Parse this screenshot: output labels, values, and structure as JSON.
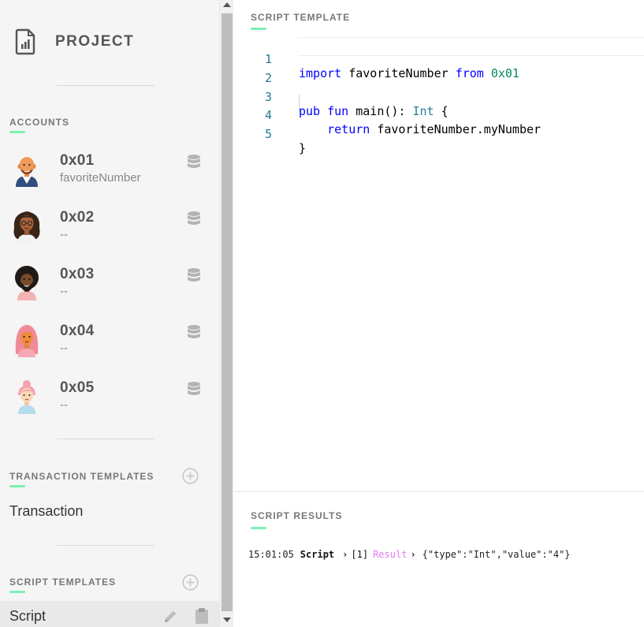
{
  "sidebar": {
    "project_label": "PROJECT",
    "accounts_title": "ACCOUNTS",
    "accounts": [
      {
        "address": "0x01",
        "contract": "favoriteNumber"
      },
      {
        "address": "0x02",
        "contract": "--"
      },
      {
        "address": "0x03",
        "contract": "--"
      },
      {
        "address": "0x04",
        "contract": "--"
      },
      {
        "address": "0x05",
        "contract": "--"
      }
    ],
    "transaction_templates_title": "TRANSACTION TEMPLATES",
    "transaction_templates": [
      "Transaction"
    ],
    "script_templates_title": "SCRIPT TEMPLATES",
    "script_templates": [
      "Script"
    ]
  },
  "editor": {
    "title": "SCRIPT TEMPLATE",
    "line_numbers": [
      "1",
      "2",
      "3",
      "4",
      "5"
    ]
  },
  "results": {
    "title": "SCRIPT RESULTS",
    "entry": {
      "time": "15:01:05",
      "kind": "Script",
      "index": "[1]",
      "label": "Result",
      "value": "{\"type\":\"Int\",\"value\":\"4\"}"
    }
  },
  "colors": {
    "accent": "#7cf0b4",
    "sidebar_bg": "#f5f5f5",
    "keyword": "#0000ff",
    "type": "#267f99",
    "result_label": "#e37cf0"
  }
}
